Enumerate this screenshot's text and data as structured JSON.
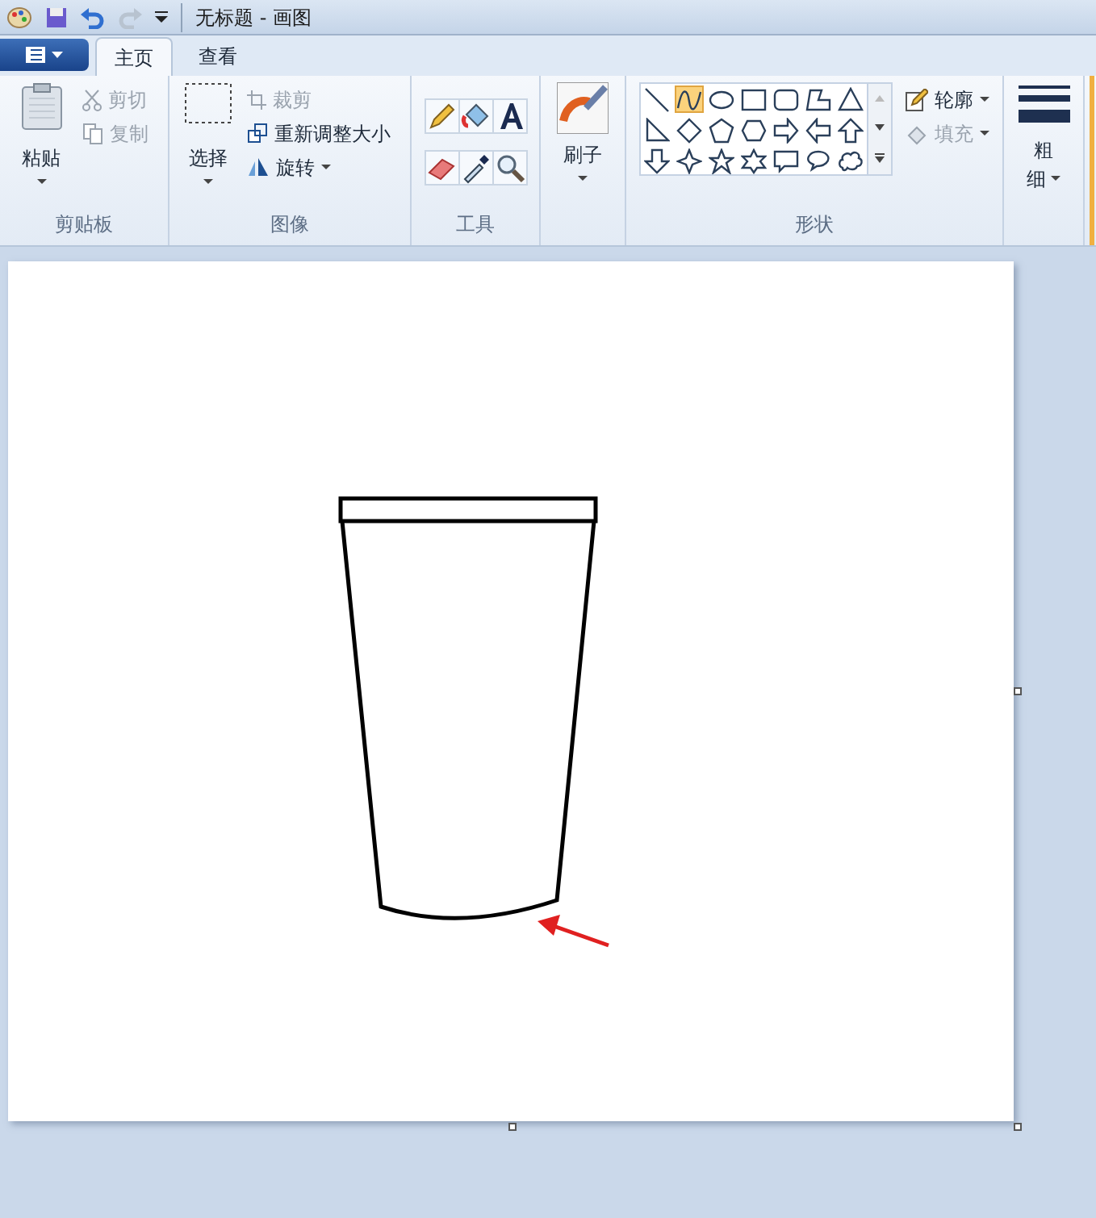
{
  "window": {
    "title": "无标题 - 画图"
  },
  "tabs": [
    {
      "label": "主页",
      "selected": true
    },
    {
      "label": "查看",
      "selected": false
    }
  ],
  "clipboard": {
    "label": "剪贴板",
    "paste": "粘贴",
    "cut": {
      "label": "剪切",
      "disabled": true
    },
    "copy": {
      "label": "复制",
      "disabled": true
    }
  },
  "image": {
    "label": "图像",
    "select": "选择",
    "crop": {
      "label": "裁剪",
      "disabled": true
    },
    "resize": {
      "label": "重新调整大小",
      "disabled": false
    },
    "rotate": {
      "label": "旋转",
      "disabled": false
    }
  },
  "tools": {
    "label": "工具"
  },
  "brushes": {
    "label": "刷子"
  },
  "shapes": {
    "label": "形状",
    "items": [
      {
        "kind": "line",
        "selected": false
      },
      {
        "kind": "curve",
        "selected": true
      },
      {
        "kind": "oval",
        "selected": false
      },
      {
        "kind": "rect",
        "selected": false
      },
      {
        "kind": "roundrect",
        "selected": false
      },
      {
        "kind": "polygon",
        "selected": false
      },
      {
        "kind": "triangle",
        "selected": false
      },
      {
        "kind": "right-triangle",
        "selected": false
      },
      {
        "kind": "diamond",
        "selected": false
      },
      {
        "kind": "pentagon",
        "selected": false
      },
      {
        "kind": "hexagon",
        "selected": false
      },
      {
        "kind": "arrow-right",
        "selected": false
      },
      {
        "kind": "arrow-left",
        "selected": false
      },
      {
        "kind": "arrow-up",
        "selected": false
      },
      {
        "kind": "arrow-down",
        "selected": false
      },
      {
        "kind": "star4",
        "selected": false
      },
      {
        "kind": "star5",
        "selected": false
      },
      {
        "kind": "star6",
        "selected": false
      },
      {
        "kind": "callout-rect",
        "selected": false
      },
      {
        "kind": "callout-oval",
        "selected": false
      },
      {
        "kind": "callout-cloud",
        "selected": false
      }
    ],
    "outline": {
      "label": "轮廓",
      "disabled": false
    },
    "fill": {
      "label": "填充",
      "disabled": true
    }
  },
  "size": {
    "label_line1": "粗",
    "label_line2": "细"
  }
}
